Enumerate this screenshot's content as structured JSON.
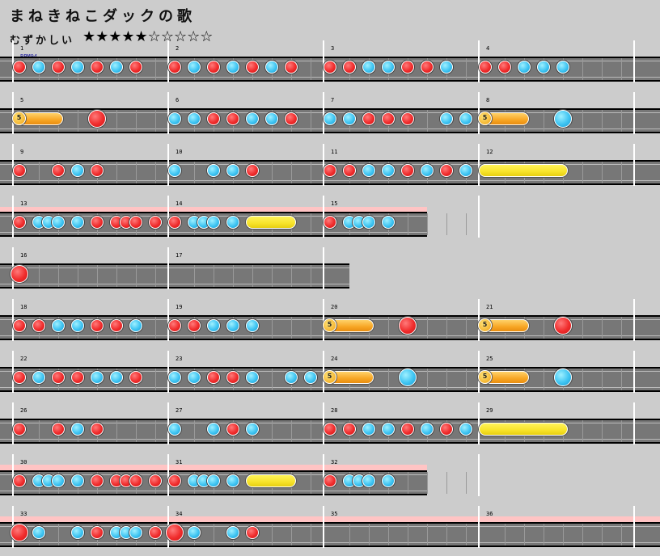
{
  "song_title": "まねきねこダックの歌",
  "difficulty_label": "むずかしい",
  "stars": "★★★★★☆☆☆☆☆",
  "star_rating": {
    "filled": 5,
    "total": 10
  },
  "bpm_text": "BPM94",
  "roll_symbol": "5",
  "colors": {
    "background": "#cccccc",
    "lane": "#777777",
    "gogo": "#ffc4c4",
    "don": "#f02c2c",
    "ka": "#3ec4f2",
    "roll": "#f7a624",
    "balloon": "#f7e32a"
  },
  "measure_numbers": [
    "1",
    "2",
    "3",
    "4",
    "5",
    "6",
    "7",
    "8",
    "9",
    "10",
    "11",
    "12",
    "13",
    "14",
    "15",
    "16",
    "17",
    "18",
    "19",
    "20",
    "21",
    "22",
    "23",
    "24",
    "25",
    "26",
    "27",
    "28",
    "29",
    "30",
    "31",
    "32",
    "33",
    "34",
    "35",
    "36"
  ]
}
